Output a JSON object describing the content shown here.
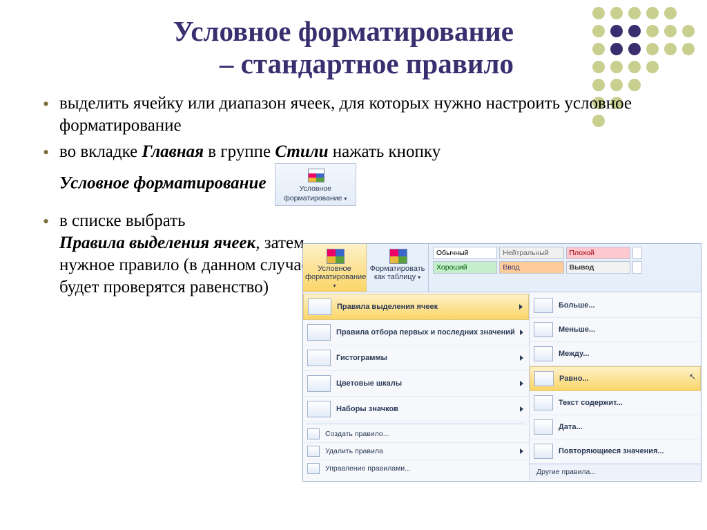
{
  "title_line1": "Условное форматирование",
  "title_line2": "– стандартное правило",
  "bullets": {
    "b1": "выделить ячейку или диапазон ячеек, для которых нужно настроить условное форматирование",
    "b2_pre": "во вкладке ",
    "b2_tab": "Главная",
    "b2_mid": " в группе ",
    "b2_grp": "Стили",
    "b2_post": " нажать кнопку ",
    "b2_btn": "Условное форматирование",
    "b3_pre": "в списке выбрать ",
    "b3_rule": "Правила выделения ячеек",
    "b3_post": ", затем нужное правило (в данном случае будет проверятся равенство)"
  },
  "cf_button": {
    "line1": "Условное",
    "line2": "форматирование"
  },
  "ribbon": {
    "btn1_l1": "Условное",
    "btn1_l2": "форматирование",
    "btn2_l1": "Форматировать",
    "btn2_l2": "как таблицу",
    "styles": {
      "normal": "Обычный",
      "neutral": "Нейтральный",
      "bad": "Плохой",
      "good": "Хороший",
      "input": "Ввод",
      "output": "Вывод"
    },
    "menu_left": {
      "m1": "Правила выделения ячеек",
      "m2": "Правила отбора первых и последних значений",
      "m3": "Гистограммы",
      "m4": "Цветовые шкалы",
      "m5": "Наборы значков",
      "m6": "Создать правило...",
      "m7": "Удалить правила",
      "m8": "Управление правилами..."
    },
    "menu_right": {
      "r1": "Больше...",
      "r2": "Меньше...",
      "r3": "Между...",
      "r4": "Равно...",
      "r5": "Текст содержит...",
      "r6": "Дата...",
      "r7": "Повторяющиеся значения...",
      "footer": "Другие правила..."
    }
  }
}
